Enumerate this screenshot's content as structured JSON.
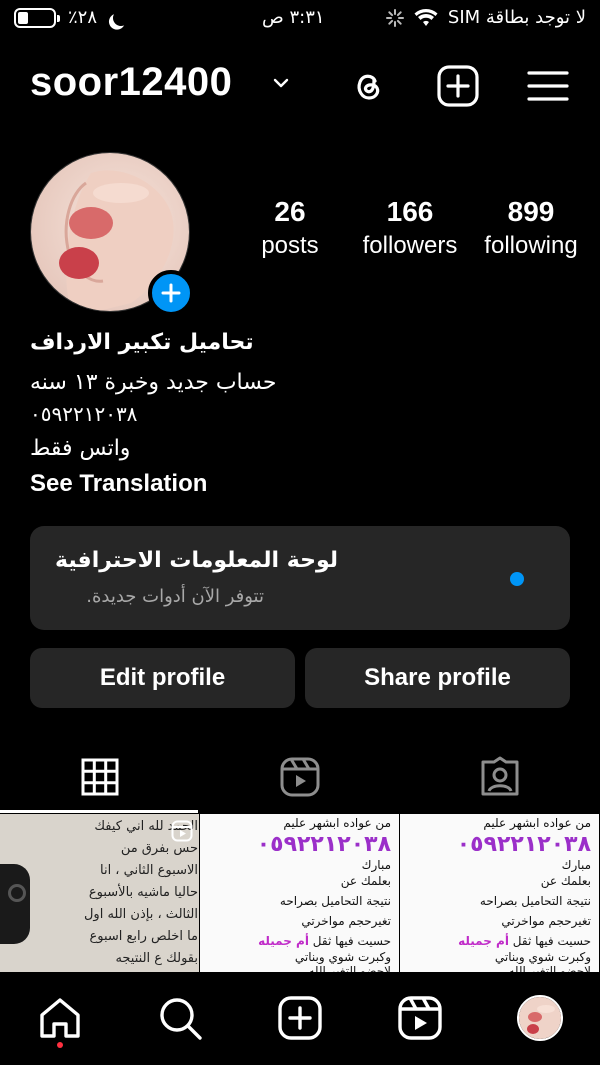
{
  "status": {
    "carrier": "لا توجد بطاقة SIM",
    "time": "٣:٣١ ص",
    "battery": "٪٢٨",
    "battery_level": 0.28
  },
  "header": {
    "username": "soor12400"
  },
  "profile": {
    "stats": [
      {
        "value": "26",
        "label": "posts"
      },
      {
        "value": "166",
        "label": "followers"
      },
      {
        "value": "899",
        "label": "following"
      }
    ],
    "bio": {
      "name": "تحاميل تكبير الارداف",
      "line1": "حساب جديد وخبرة ١٣ سنه",
      "line2": "٠٥٩٢٢١٢٠٣٨",
      "line3": "واتس فقط",
      "see_translation": "See Translation"
    }
  },
  "dashboard": {
    "title": "لوحة المعلومات الاحترافية",
    "subtitle": "تتوفر الآن أدوات جديدة."
  },
  "buttons": {
    "edit": "Edit profile",
    "share": "Share profile"
  },
  "grid": {
    "post1_lines": [
      "الحمد لله اني كيفك",
      "حس بفرق من",
      "الاسبوع الثاني ، انا",
      "حاليا ماشيه بالأسبوع",
      "الثالث ، بإذن الله اول",
      "ما اخلص رابع اسبوع",
      "بقولك ع النتيجه"
    ],
    "ad_top": "من عواده ابشهر عليم",
    "ad_phone": "٠٥٩٢٢١٢٠٣٨",
    "ad_lines": [
      "مبارك",
      "بعلمك عن",
      "نتيجة التحاميل بصراحه",
      "تغيرحجم مواخرتي",
      "حسيت فيها ثقل",
      "وكبرت شوي وبناتي",
      "لاحضو التغير الله"
    ],
    "ad_highlight": "أم جميله"
  },
  "icons": {
    "accent": "#0095f6",
    "notification": "#ff3040"
  }
}
